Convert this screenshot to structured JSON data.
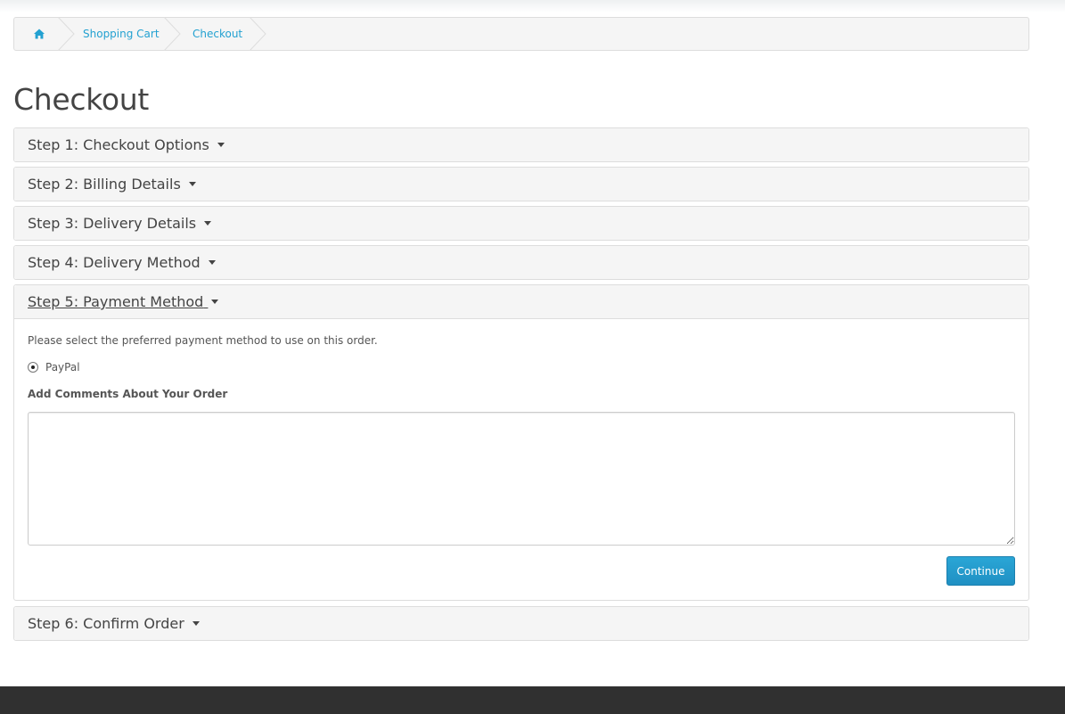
{
  "breadcrumb": {
    "home_icon": "home-icon",
    "items": [
      "Shopping Cart",
      "Checkout"
    ]
  },
  "page_title": "Checkout",
  "steps": [
    {
      "label": "Step 1: Checkout Options"
    },
    {
      "label": "Step 2: Billing Details"
    },
    {
      "label": "Step 3: Delivery Details"
    },
    {
      "label": "Step 4: Delivery Method"
    },
    {
      "label": "Step 5: Payment Method"
    },
    {
      "label": "Step 6: Confirm Order"
    }
  ],
  "payment": {
    "intro": "Please select the preferred payment method to use on this order.",
    "method_label": "PayPal",
    "method_selected": true,
    "comments_label": "Add Comments About Your Order",
    "comments_value": "",
    "continue_label": "Continue"
  },
  "colors": {
    "link": "#23a1d1",
    "button": "#229ac8",
    "footer": "#303030",
    "panel_heading": "#f5f5f5"
  }
}
